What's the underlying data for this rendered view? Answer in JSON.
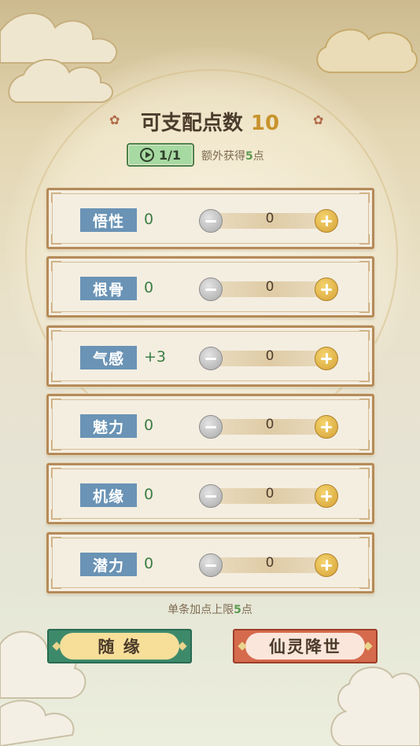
{
  "header": {
    "title": "可支配点数",
    "points": "10"
  },
  "ad": {
    "counter": "1/1",
    "extra_prefix": "额外获得",
    "extra_amount": "5",
    "extra_suffix": "点"
  },
  "stats": [
    {
      "label": "悟性",
      "value": "0",
      "alloc": "0"
    },
    {
      "label": "根骨",
      "value": "0",
      "alloc": "0"
    },
    {
      "label": "气感",
      "value": "+3",
      "alloc": "0"
    },
    {
      "label": "魅力",
      "value": "0",
      "alloc": "0"
    },
    {
      "label": "机缘",
      "value": "0",
      "alloc": "0"
    },
    {
      "label": "潜力",
      "value": "0",
      "alloc": "0"
    }
  ],
  "limit": {
    "prefix": "单条加点上限",
    "amount": "5",
    "suffix": "点"
  },
  "buttons": {
    "fate": "随 缘",
    "spirit": "仙灵降世"
  },
  "colors": {
    "accent_gold": "#c8932c",
    "stat_value_green": "#3b7d43",
    "label_blue": "#6a93b5",
    "fate_green": "#3d8a6b",
    "spirit_red": "#d56a4c"
  }
}
